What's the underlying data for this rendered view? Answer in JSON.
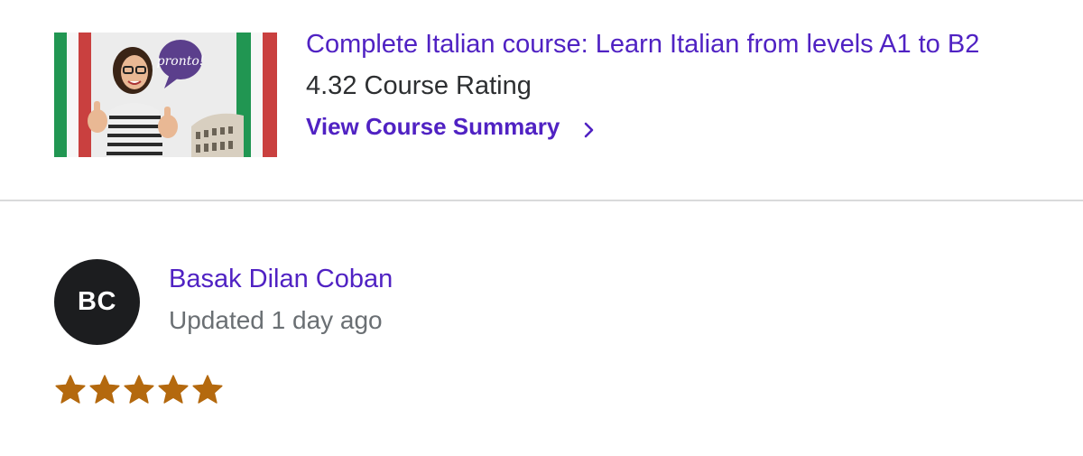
{
  "course": {
    "thumbnail_badge": "pronto!",
    "title": "Complete Italian course: Learn Italian from levels A1 to B2",
    "rating_text": "4.32 Course Rating",
    "summary_link": "View Course Summary",
    "chevron_icon": "chevron-right-icon"
  },
  "review": {
    "avatar_initials": "BC",
    "reviewer_name": "Basak Dilan Coban",
    "updated": "Updated 1 day ago",
    "star_rating": 5,
    "star_max": 5,
    "star_icon": "star-icon"
  },
  "colors": {
    "link_purple": "#5022c3",
    "text_dark": "#2d2f31",
    "text_muted": "#6a6f73",
    "avatar_bg": "#1c1d1f",
    "star_gold": "#b4690e",
    "divider": "#d9dadb",
    "flag_green": "#219652",
    "flag_red": "#c9403f"
  }
}
